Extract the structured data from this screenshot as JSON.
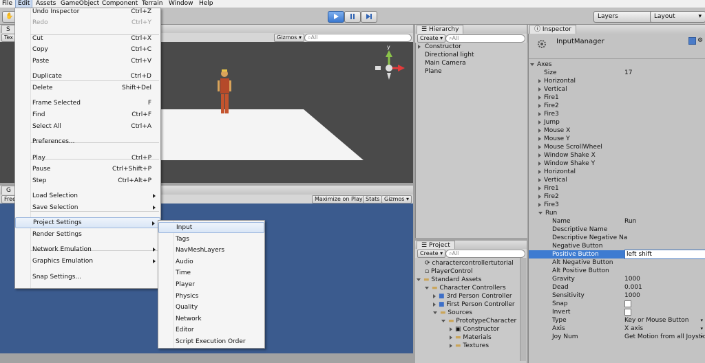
{
  "menubar": [
    "File",
    "Edit",
    "Assets",
    "GameObject",
    "Component",
    "Terrain",
    "Window",
    "Help"
  ],
  "toolbar": {
    "layers": "Layers",
    "layout": "Layout"
  },
  "scene": {
    "tab": "S",
    "sub": "Tex",
    "gizmos": "Gizmos",
    "search": "All",
    "persp": "y"
  },
  "game": {
    "tab": "G",
    "sub": "Free",
    "maximize": "Maximize on Play",
    "stats": "Stats",
    "gizmos": "Gizmos"
  },
  "hierarchy": {
    "tab": "Hierarchy",
    "create": "Create",
    "search": "All",
    "items": [
      "Constructor",
      "Directional light",
      "Main Camera",
      "Plane"
    ]
  },
  "project": {
    "tab": "Project",
    "create": "Create",
    "search": "All",
    "items": [
      "charactercontrollertutorial",
      "PlayerControl",
      "Standard Assets",
      "Character Controllers",
      "3rd Person Controller",
      "First Person Controller",
      "Sources",
      "PrototypeCharacter",
      "Constructor",
      "Materials",
      "Textures"
    ]
  },
  "inspector": {
    "tab": "Inspector",
    "title": "InputManager",
    "axes": "Axes",
    "size_label": "Size",
    "size_value": "17",
    "axis_items": [
      "Horizontal",
      "Vertical",
      "Fire1",
      "Fire2",
      "Fire3",
      "Jump",
      "Mouse X",
      "Mouse Y",
      "Mouse ScrollWheel",
      "Window Shake X",
      "Window Shake Y",
      "Horizontal",
      "Vertical",
      "Fire1",
      "Fire2",
      "Fire3"
    ],
    "run": "Run",
    "props": [
      {
        "label": "Name",
        "value": "Run"
      },
      {
        "label": "Descriptive Name",
        "value": ""
      },
      {
        "label": "Descriptive Negative Na",
        "value": ""
      },
      {
        "label": "Negative Button",
        "value": ""
      },
      {
        "label": "Positive Button",
        "value": "left shift"
      },
      {
        "label": "Alt Negative Button",
        "value": ""
      },
      {
        "label": "Alt Positive Button",
        "value": ""
      },
      {
        "label": "Gravity",
        "value": "1000"
      },
      {
        "label": "Dead",
        "value": "0.001"
      },
      {
        "label": "Sensitivity",
        "value": "1000"
      },
      {
        "label": "Snap",
        "value": ""
      },
      {
        "label": "Invert",
        "value": ""
      },
      {
        "label": "Type",
        "value": "Key or Mouse Button"
      },
      {
        "label": "Axis",
        "value": "X axis"
      },
      {
        "label": "Joy Num",
        "value": "Get Motion from all Joystic"
      }
    ]
  },
  "edit_menu": [
    {
      "label": "Undo Inspector",
      "shortcut": "Ctrl+Z"
    },
    {
      "label": "Redo",
      "shortcut": "Ctrl+Y"
    },
    {
      "label": "Cut",
      "shortcut": "Ctrl+X"
    },
    {
      "label": "Copy",
      "shortcut": "Ctrl+C"
    },
    {
      "label": "Paste",
      "shortcut": "Ctrl+V"
    },
    {
      "label": "Duplicate",
      "shortcut": "Ctrl+D"
    },
    {
      "label": "Delete",
      "shortcut": "Shift+Del"
    },
    {
      "label": "Frame Selected",
      "shortcut": "F"
    },
    {
      "label": "Find",
      "shortcut": "Ctrl+F"
    },
    {
      "label": "Select All",
      "shortcut": "Ctrl+A"
    },
    {
      "label": "Preferences...",
      "shortcut": ""
    },
    {
      "label": "Play",
      "shortcut": "Ctrl+P"
    },
    {
      "label": "Pause",
      "shortcut": "Ctrl+Shift+P"
    },
    {
      "label": "Step",
      "shortcut": "Ctrl+Alt+P"
    },
    {
      "label": "Load Selection",
      "shortcut": ""
    },
    {
      "label": "Save Selection",
      "shortcut": ""
    },
    {
      "label": "Project Settings",
      "shortcut": ""
    },
    {
      "label": "Render Settings",
      "shortcut": ""
    },
    {
      "label": "Network Emulation",
      "shortcut": ""
    },
    {
      "label": "Graphics Emulation",
      "shortcut": ""
    },
    {
      "label": "Snap Settings...",
      "shortcut": ""
    }
  ],
  "project_settings_menu": [
    "Input",
    "Tags",
    "NavMeshLayers",
    "Audio",
    "Time",
    "Player",
    "Physics",
    "Quality",
    "Network",
    "Editor",
    "Script Execution Order"
  ]
}
